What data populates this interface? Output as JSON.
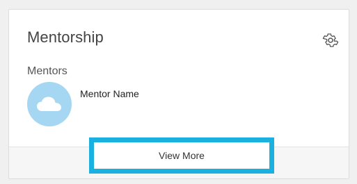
{
  "card": {
    "title": "Mentorship",
    "settings_icon": "gear-icon"
  },
  "mentors": {
    "label": "Mentors",
    "items": [
      {
        "name": "Mentor Name",
        "avatar_icon": "cloud-icon",
        "avatar_color": "#a5d6f2"
      }
    ]
  },
  "footer": {
    "view_more_label": "View More",
    "highlight_color": "#1ab0e0"
  }
}
